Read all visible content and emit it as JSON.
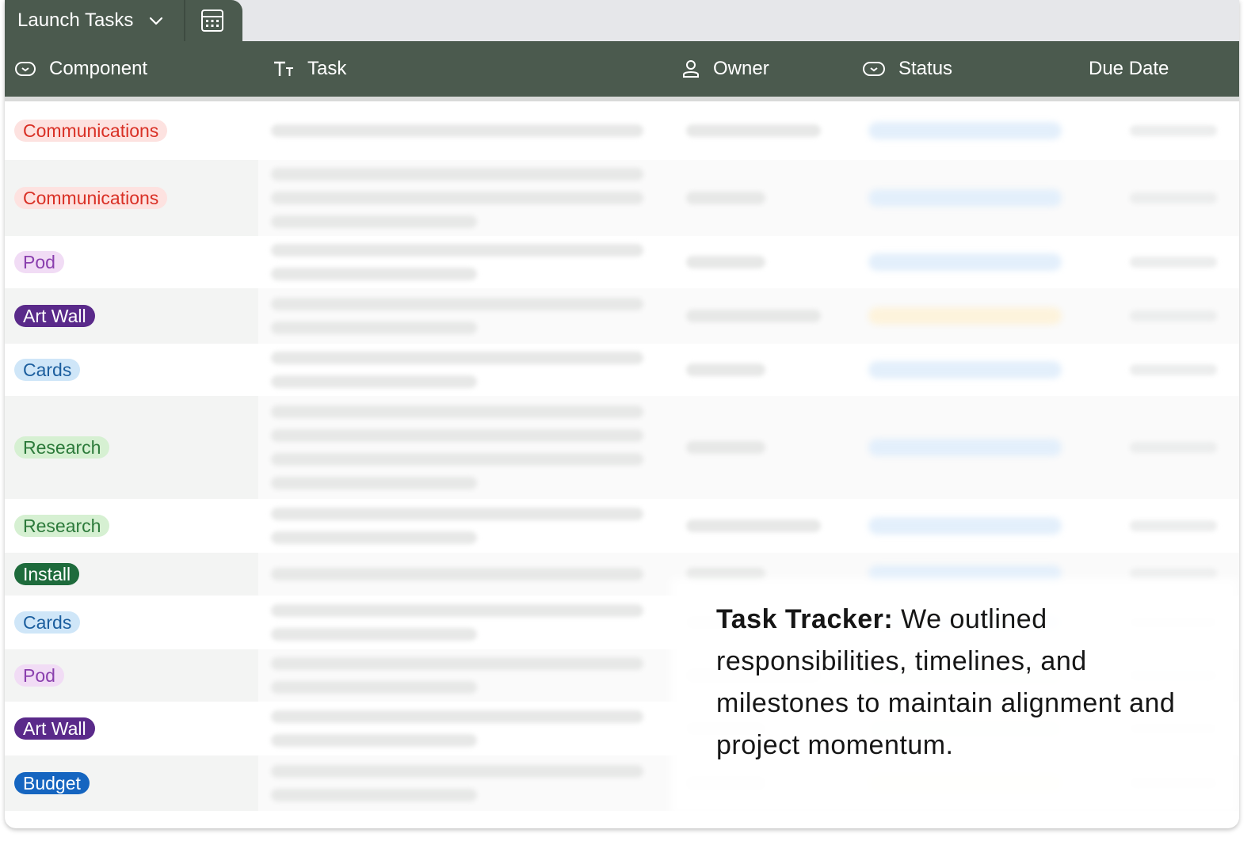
{
  "tab": {
    "title": "Launch Tasks"
  },
  "columns": {
    "component": "Component",
    "task": "Task",
    "owner": "Owner",
    "status": "Status",
    "due_date": "Due Date"
  },
  "rows": [
    {
      "component": "Communications",
      "color": "#d93025",
      "bg": "#fde2e0"
    },
    {
      "component": "Communications",
      "color": "#d93025",
      "bg": "#fde2e0"
    },
    {
      "component": "Pod",
      "color": "#8a3fae",
      "bg": "#f1dcf5"
    },
    {
      "component": "Art Wall",
      "color": "#ffffff",
      "bg": "#5a2a8a"
    },
    {
      "component": "Cards",
      "color": "#1b5e9e",
      "bg": "#cfe6f8"
    },
    {
      "component": "Research",
      "color": "#2c7a3a",
      "bg": "#d6f0d2"
    },
    {
      "component": "Research",
      "color": "#2c7a3a",
      "bg": "#d6f0d2"
    },
    {
      "component": "Install",
      "color": "#ffffff",
      "bg": "#1e6b3c"
    },
    {
      "component": "Cards",
      "color": "#1b5e9e",
      "bg": "#cfe6f8"
    },
    {
      "component": "Pod",
      "color": "#8a3fae",
      "bg": "#f1dcf5"
    },
    {
      "component": "Art Wall",
      "color": "#ffffff",
      "bg": "#5a2a8a"
    },
    {
      "component": "Budget",
      "color": "#ffffff",
      "bg": "#1565c0"
    }
  ],
  "caption": {
    "lead": "Task Tracker:",
    "body": " We outlined responsibilities, timelines, and milestones to maintain alignment and project momentum."
  },
  "icons": {
    "dropdown": "chevron-down-icon",
    "calculator": "calculator-icon",
    "component": "select-icon",
    "task": "text-icon",
    "owner": "person-icon",
    "status": "select-icon"
  }
}
